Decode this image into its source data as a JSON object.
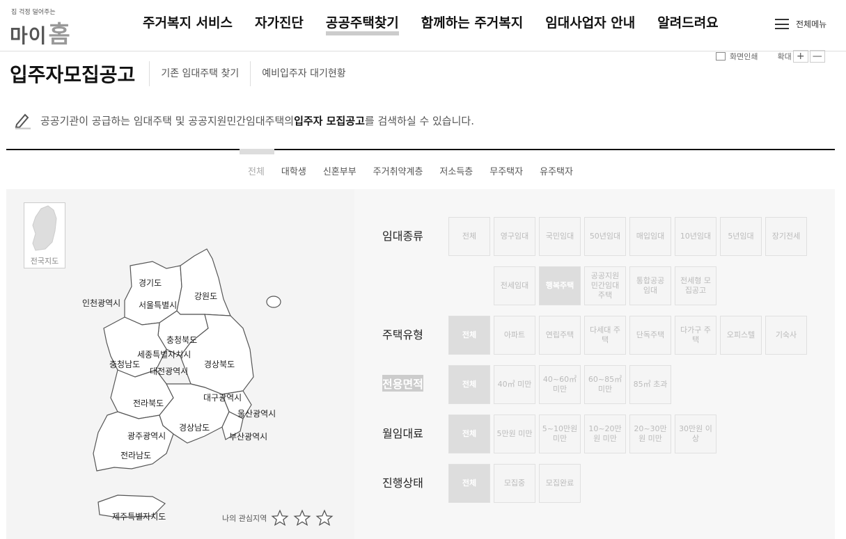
{
  "header": {
    "logo_tag": "집 걱정 덜어주는",
    "logo_text": "마이",
    "logo_home": "홈",
    "nav": [
      "주거복지 서비스",
      "자가진단",
      "공공주택찾기",
      "함께하는 주거복지",
      "임대사업자 안내",
      "알려드려요"
    ],
    "allmenu": "전체메뉴"
  },
  "util": {
    "print": "화면인쇄",
    "zoom": "확대",
    "plus": "+",
    "minus": "—"
  },
  "title": {
    "main": "입주자모집공고",
    "subtabs": [
      "기존 임대주택 찾기",
      "예비입주자 대기현황"
    ]
  },
  "desc": {
    "pre": "공공기관이 공급하는 임대주택 및 공공지원민간임대주택의 ",
    "bold": "입주자 모집공고",
    "post": "를 검색하실 수 있습니다."
  },
  "categories": [
    "전체",
    "대학생",
    "신혼부부",
    "주거취약계층",
    "저소득층",
    "무주택자",
    "유주택자"
  ],
  "map": {
    "mini_label": "전국지도",
    "regions": [
      "경기도",
      "강원도",
      "인천광역시",
      "서울특별시",
      "충청북도",
      "세종특별자치시",
      "충청남도",
      "경상북도",
      "대전광역시",
      "대구광역시",
      "전라북도",
      "울산광역시",
      "경상남도",
      "광주광역시",
      "부산광역시",
      "전라남도",
      "제주특별자치도"
    ],
    "fav_label": "나의 관심지역"
  },
  "filters": {
    "rent_type": {
      "label": "임대종류",
      "options": [
        "전체",
        "영구임대",
        "국민임대",
        "50년임대",
        "매입임대",
        "10년임대",
        "5년임대",
        "장기전세",
        "전세임대",
        "행복주택",
        "공공지원 민간임대 주택",
        "통합공공 임대",
        "전세형 모집공고"
      ]
    },
    "house_type": {
      "label": "주택유형",
      "options": [
        "전체",
        "아파트",
        "연립주택",
        "다세대 주택",
        "단독주택",
        "다가구 주택",
        "오피스텔",
        "기숙사"
      ]
    },
    "area": {
      "label": "전용면적",
      "options": [
        "전체",
        "40㎡ 미만",
        "40~60㎡ 미만",
        "60~85㎡ 미만",
        "85㎡ 초과"
      ]
    },
    "rent": {
      "label": "월임대료",
      "options": [
        "전체",
        "5만원 미만",
        "5~10만원 미만",
        "10~20만원 미만",
        "20~30만원 미만",
        "30만원 이상"
      ]
    },
    "status": {
      "label": "진행상태",
      "options": [
        "전체",
        "모집중",
        "모집완료"
      ]
    }
  }
}
